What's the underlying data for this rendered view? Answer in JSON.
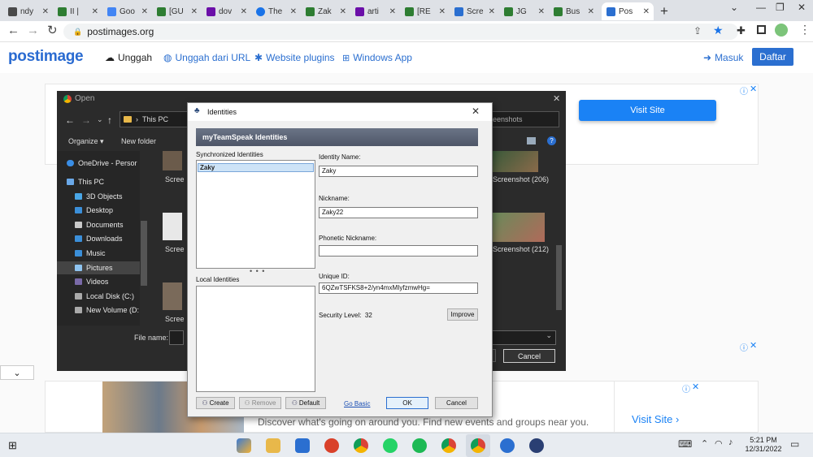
{
  "browser": {
    "tabs": [
      {
        "title": "ndy",
        "fav": "#4a4a4a"
      },
      {
        "title": "II |",
        "fav": "#2e7d32"
      },
      {
        "title": "Goo",
        "fav": "#4285f4"
      },
      {
        "title": "[GU",
        "fav": "#2e7d32"
      },
      {
        "title": "dov",
        "fav": "#6b0fa8"
      },
      {
        "title": "The",
        "fav": "#1a73e8"
      },
      {
        "title": "Zak",
        "fav": "#2e7d32"
      },
      {
        "title": "arti",
        "fav": "#6b0fa8"
      },
      {
        "title": "[RE",
        "fav": "#2e7d32"
      },
      {
        "title": "Scre",
        "fav": "#2b6fd0"
      },
      {
        "title": "JG",
        "fav": "#2e7d32"
      },
      {
        "title": "Bus",
        "fav": "#2e7d32"
      },
      {
        "title": "Pos",
        "fav": "#2b6fd0"
      }
    ],
    "url": "postimages.org"
  },
  "site": {
    "logo": "postimage",
    "nav": {
      "upload": "Unggah",
      "upload_url": "Unggah dari URL",
      "plugins": "Website plugins",
      "windows_app": "Windows App"
    },
    "login": "Masuk",
    "register": "Daftar",
    "ad_visit": "Visit Site",
    "ad_text": "Discover what's going on around you. Find new events and groups near you.",
    "ad_visit2": "Visit Site"
  },
  "file_dialog": {
    "title": "Open",
    "path": "This PC",
    "search_placeholder": "reenshots",
    "organize": "Organize",
    "new_folder": "New folder",
    "nav_items": [
      "OneDrive - Persor",
      "This PC",
      "3D Objects",
      "Desktop",
      "Documents",
      "Downloads",
      "Music",
      "Pictures",
      "Videos",
      "Local Disk (C:)",
      "New Volume (D:"
    ],
    "thumbs": [
      "Scree",
      "Scree",
      "Scree",
      "Screenshot (206)",
      "Screenshot (212)"
    ],
    "file_name_label": "File name:",
    "cancel": "Cancel"
  },
  "identities": {
    "title": "Identities",
    "banner": "myTeamSpeak Identities",
    "synced_label": "Synchronized Identities",
    "synced_items": [
      "Zaky"
    ],
    "local_label": "Local Identities",
    "identity_name_label": "Identity Name:",
    "identity_name": "Zaky",
    "nickname_label": "Nickname:",
    "nickname": "Zaky22",
    "phonetic_label": "Phonetic Nickname:",
    "phonetic": "",
    "uid_label": "Unique ID:",
    "uid": "6QZwTSFKS8+2/yn4mxMIyfzmwHg=",
    "security_label": "Security Level:",
    "security_value": "32",
    "improve": "Improve",
    "create": "Create",
    "remove": "Remove",
    "default": "Default",
    "go_basic": "Go Basic",
    "ok": "OK",
    "cancel": "Cancel"
  },
  "taskbar": {
    "time": "5:21 PM",
    "date": "12/31/2022"
  }
}
